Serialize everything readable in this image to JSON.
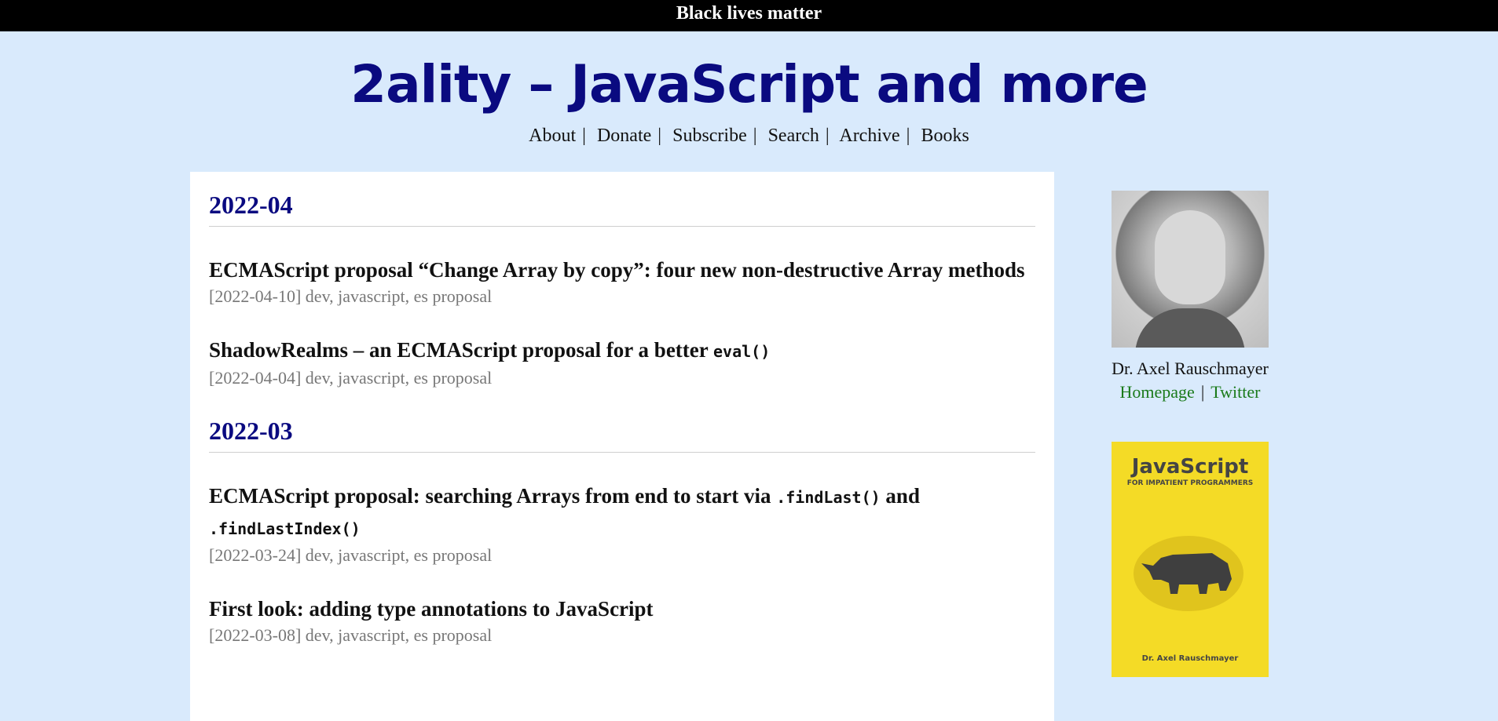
{
  "banner": "Black lives matter",
  "site": {
    "title": "2ality – JavaScript and more"
  },
  "nav": [
    "About",
    "Donate",
    "Subscribe",
    "Search",
    "Archive",
    "Books"
  ],
  "months": [
    {
      "label": "2022-04",
      "posts": [
        {
          "title_parts": [
            "ECMAScript proposal “Change Array by copy”: four new non-destructive Array methods"
          ],
          "meta": "[2022-04-10] dev, javascript, es proposal"
        },
        {
          "title_parts": [
            "ShadowRealms – an ECMAScript proposal for a better ",
            "eval()"
          ],
          "meta": "[2022-04-04] dev, javascript, es proposal"
        }
      ]
    },
    {
      "label": "2022-03",
      "posts": [
        {
          "title_parts": [
            "ECMAScript proposal: searching Arrays from end to start via ",
            ".findLast()",
            " and ",
            ".findLastIndex()"
          ],
          "meta": "[2022-03-24] dev, javascript, es proposal"
        },
        {
          "title_parts": [
            "First look: adding type annotations to JavaScript"
          ],
          "meta": "[2022-03-08] dev, javascript, es proposal"
        }
      ]
    }
  ],
  "sidebar": {
    "author_name": "Dr. Axel Rauschmayer",
    "links": [
      "Homepage",
      "Twitter"
    ],
    "book": {
      "title": "JavaScript",
      "subtitle": "FOR IMPATIENT PROGRAMMERS",
      "author": "Dr. Axel Rauschmayer"
    }
  }
}
